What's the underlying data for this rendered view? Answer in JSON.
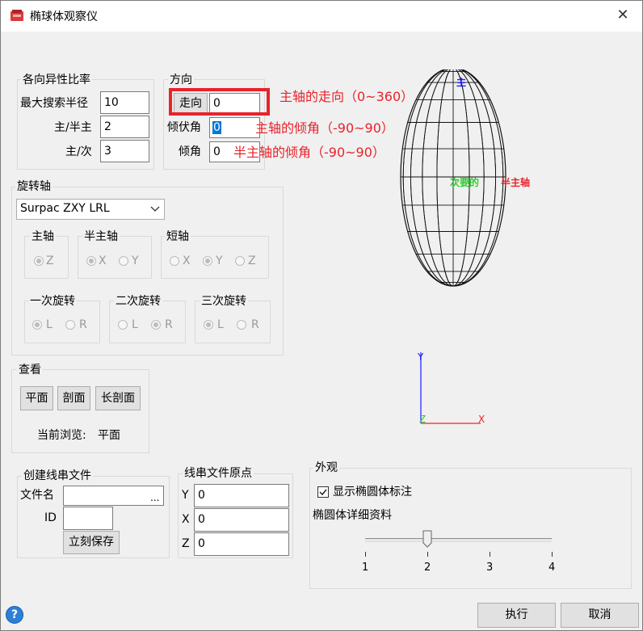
{
  "window": {
    "title": "椭球体观察仪",
    "close_glyph": "✕"
  },
  "anisotropy": {
    "label": "各向异性比率",
    "max_search_radius_label": "最大搜索半径",
    "max_search_radius": "10",
    "major_semi_label": "主/半主",
    "major_semi": "2",
    "major_minor_label": "主/次",
    "major_minor": "3"
  },
  "orientation": {
    "label": "方向",
    "bearing_label": "走向",
    "bearing": "0",
    "plunge_label": "倾伏角",
    "plunge": "0",
    "dip_label": "倾角",
    "dip": "0"
  },
  "annotations": {
    "bearing": "主轴的走向（0~360）",
    "plunge": "主轴的倾角（-90~90）",
    "dip": "半主轴的倾角（-90~90）"
  },
  "rotation": {
    "label": "旋转轴",
    "preset": "Surpac ZXY LRL",
    "major": {
      "label": "主轴",
      "options": [
        "Z"
      ],
      "selected": "Z"
    },
    "semi": {
      "label": "半主轴",
      "options": [
        "X",
        "Y"
      ],
      "selected": "X"
    },
    "minor": {
      "label": "短轴",
      "options": [
        "X",
        "Y",
        "Z"
      ],
      "selected": "Y"
    },
    "first": {
      "label": "一次旋转",
      "options": [
        "L",
        "R"
      ],
      "selected": "L"
    },
    "second": {
      "label": "二次旋转",
      "options": [
        "L",
        "R"
      ],
      "selected": "R"
    },
    "third": {
      "label": "三次旋转",
      "options": [
        "L",
        "R"
      ],
      "selected": "L"
    }
  },
  "view": {
    "label": "查看",
    "plan": "平面",
    "section": "剖面",
    "long_section": "长剖面",
    "current_label": "当前浏览:",
    "current": "平面"
  },
  "create_string": {
    "label": "创建线串文件",
    "filename_label": "文件名",
    "filename": "",
    "browse": "...",
    "id_label": "ID",
    "id": "",
    "save_now": "立刻保存"
  },
  "origin": {
    "label": "线串文件原点",
    "y_label": "Y",
    "y": "0",
    "x_label": "X",
    "x": "0",
    "z_label": "Z",
    "z": "0"
  },
  "appearance": {
    "label": "外观",
    "show_labels": "显示椭圆体标注",
    "detail_label": "椭圆体详细资料",
    "ticks": [
      "1",
      "2",
      "3",
      "4"
    ],
    "detail_value": 2
  },
  "preview": {
    "major": "主",
    "semi": "半主轴",
    "minor": "次要的",
    "axis_y": "Y",
    "axis_x": "X",
    "axis_z": "Z",
    "colors": {
      "major": "#1a1aff",
      "semi": "#e8232b",
      "minor": "#33cc33"
    }
  },
  "footer": {
    "help": "?",
    "ok": "执行",
    "cancel": "取消"
  }
}
